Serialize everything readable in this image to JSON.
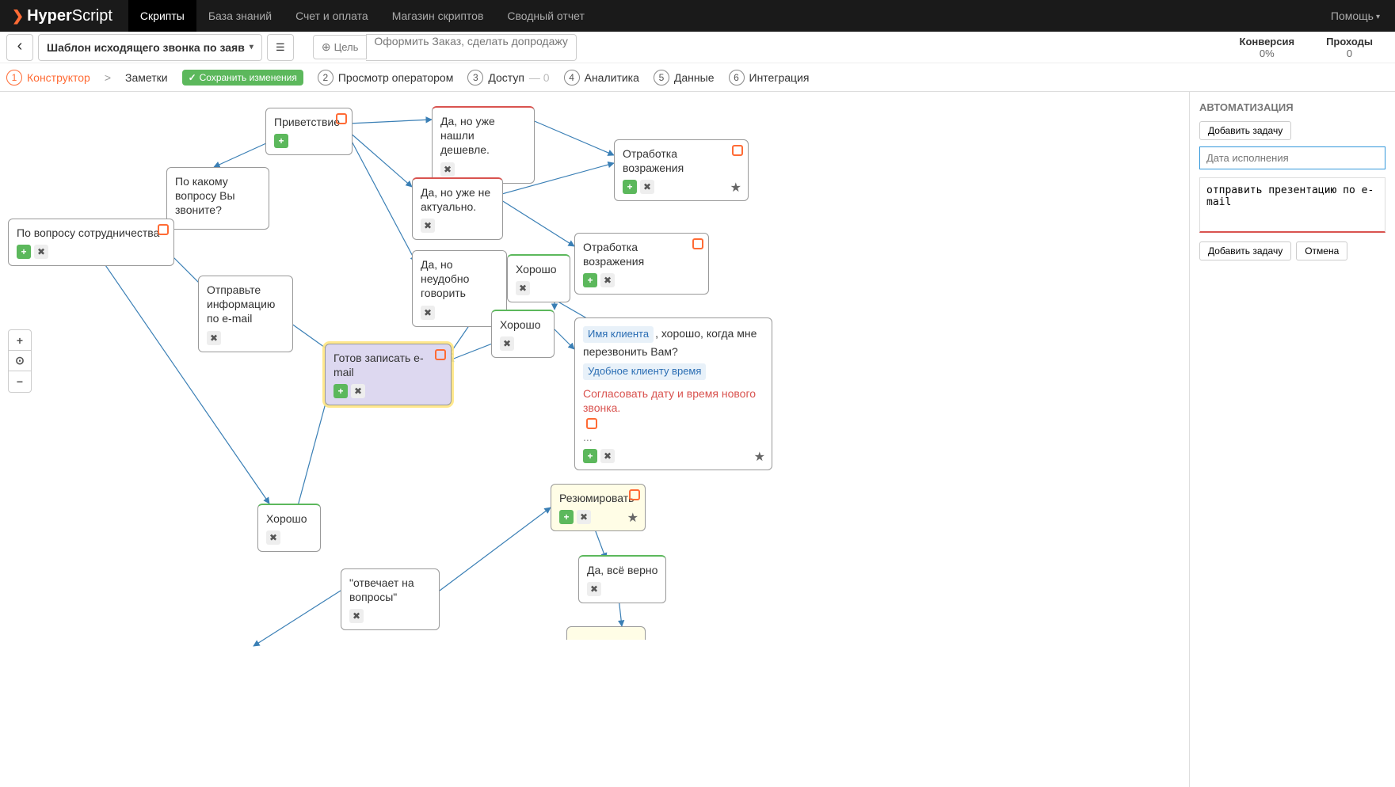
{
  "nav": {
    "logo_bold": "Hyper",
    "logo_light": "Script",
    "links": [
      "Скрипты",
      "База знаний",
      "Счет и оплата",
      "Магазин скриптов",
      "Сводный отчет"
    ],
    "help": "Помощь"
  },
  "toolbar": {
    "script_name": "Шаблон исходящего звонка по заяв",
    "goal_label": "Цель",
    "goal_value": "Оформить Заказ, сделать допродажу",
    "stats": {
      "conversion_label": "Конверсия",
      "conversion_val": "0%",
      "passes_label": "Проходы",
      "passes_val": "0"
    }
  },
  "tabs": {
    "t1": "Конструктор",
    "notes": "Заметки",
    "save": "Сохранить изменения",
    "t2": "Просмотр оператором",
    "t3": "Доступ",
    "t3_sub": "— 0",
    "t4": "Аналитика",
    "t5": "Данные",
    "t6": "Интеграция"
  },
  "panel": {
    "heading": "АВТОМАТИЗАЦИЯ",
    "add_task": "Добавить задачу",
    "date_placeholder": "Дата исполнения",
    "task_text": "отправить презентацию по e-mail",
    "add_task2": "Добавить задачу",
    "cancel": "Отмена"
  },
  "nodes": {
    "greeting": "Приветствие",
    "question": "По какому вопросу Вы звоните?",
    "coop": "По вопросу сотрудничества",
    "found_cheaper": "Да, но уже нашли дешевле.",
    "not_actual": "Да, но уже не актуально.",
    "busy": "Да, но неудобно говорить",
    "objection1": "Отработка возражения",
    "objection2": "Отработка возражения",
    "send_email": "Отправьте информацию по e-mail",
    "ok1": "Хорошо",
    "ok2": "Хорошо",
    "ok3": "Хорошо",
    "ready_email": "Готов записать e-mail",
    "detail_client": "Имя клиента",
    "detail_text1": ", хорошо, когда мне перезвонить Вам?",
    "detail_chip2": "Удобное клиенту время",
    "detail_red": "Согласовать дату и время нового звонка.",
    "detail_dots": "...",
    "resume": "Резюмировать",
    "yes_correct": "Да, всё верно",
    "answers": "\"отвечает на вопросы\""
  }
}
